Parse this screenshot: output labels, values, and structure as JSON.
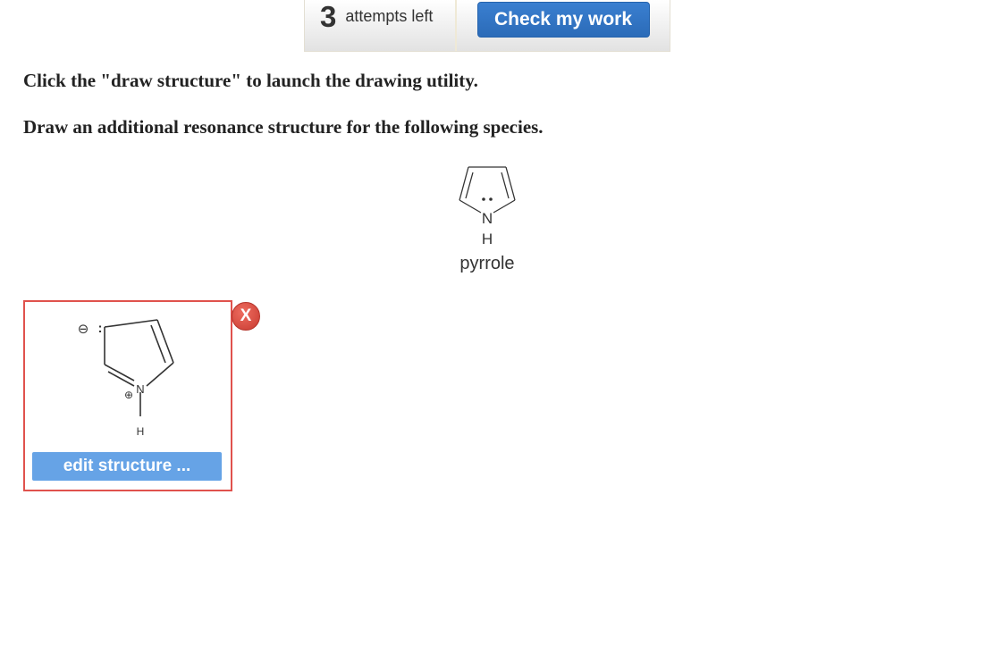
{
  "toolbar": {
    "attempts_count": "3",
    "attempts_label": "attempts left",
    "check_button_label": "Check my work"
  },
  "instructions": [
    "Click the \"draw structure\" to launch the drawing utility.",
    "Draw an additional resonance structure for the following species."
  ],
  "molecule": {
    "name": "pyrrole",
    "atom_n": "N",
    "atom_h": "H"
  },
  "answer": {
    "edit_button_label": "edit structure ...",
    "atom_n": "N",
    "atom_h": "H",
    "negative_charge": "⊖",
    "positive_charge": "⊕",
    "lone_pair": ":"
  },
  "delete_button_label": "X",
  "colors": {
    "primary_button": "#2b6bb8",
    "edit_button": "#66a3e6",
    "answer_border": "#e0524d",
    "delete_button": "#d9463b"
  }
}
